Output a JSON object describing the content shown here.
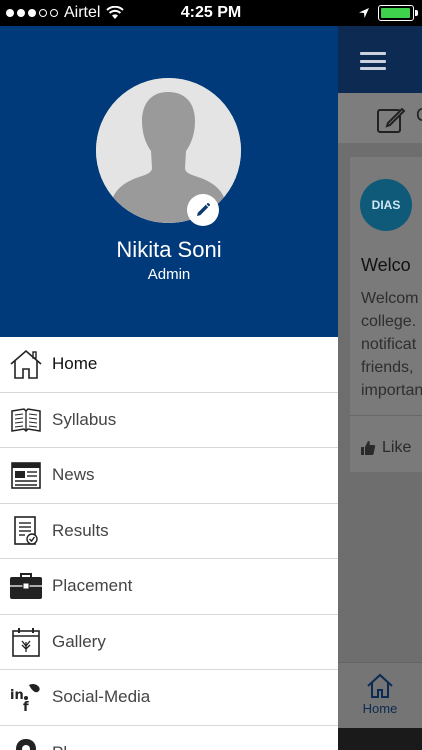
{
  "status": {
    "carrier": "Airtel",
    "time": "4:25 PM",
    "signal_bars": 3,
    "battery_level": 0.95,
    "battery_color": "#3fd24d"
  },
  "profile": {
    "name": "Nikita Soni",
    "role": "Admin",
    "background": "#003a7a"
  },
  "menu": [
    {
      "label": "Home",
      "icon": "home-icon",
      "active": true
    },
    {
      "label": "Syllabus",
      "icon": "book-icon"
    },
    {
      "label": "News",
      "icon": "newspaper-icon"
    },
    {
      "label": "Results",
      "icon": "results-icon"
    },
    {
      "label": "Placement",
      "icon": "briefcase-icon"
    },
    {
      "label": "Gallery",
      "icon": "gallery-icon"
    },
    {
      "label": "Social-Media",
      "icon": "social-media-icon"
    },
    {
      "label": "Pl",
      "icon": "location-icon"
    }
  ],
  "background_app": {
    "compose_text": "C",
    "logo_text": "DIAS",
    "card_title": "Welco",
    "card_lines": [
      "Welcom",
      "college.",
      "notificat",
      "friends,",
      "importan"
    ],
    "like_label": "Like",
    "bottom_tab_label": "Home"
  }
}
